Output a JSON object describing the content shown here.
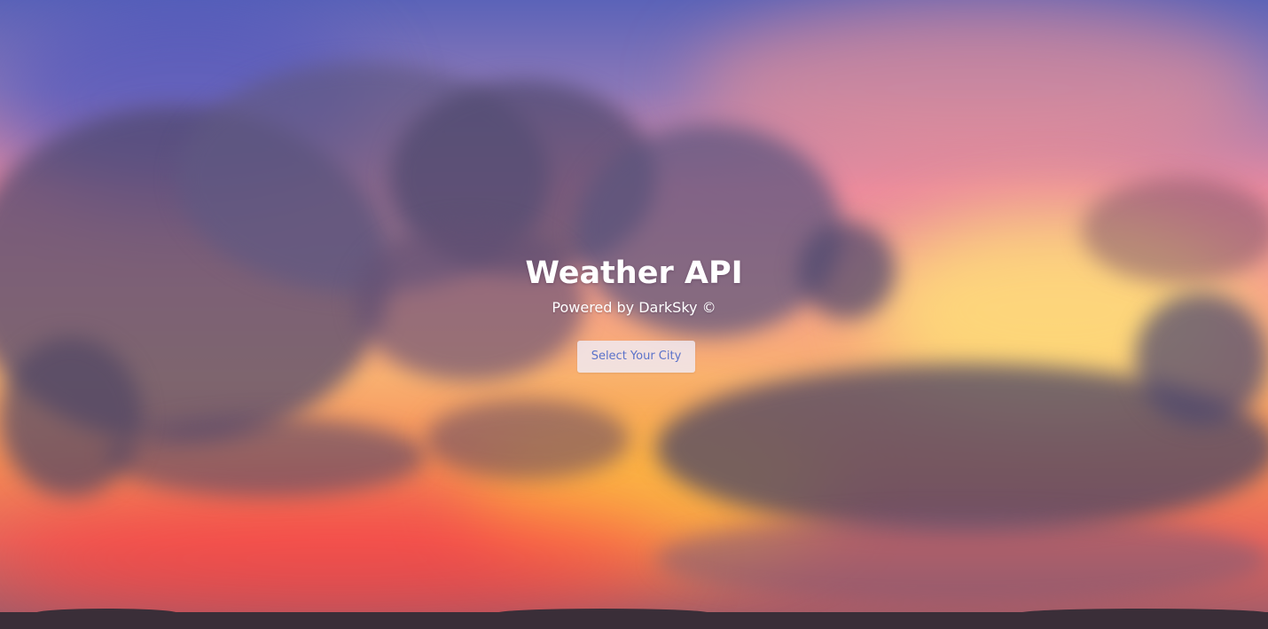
{
  "hero": {
    "title": "Weather API",
    "subtitle": "Powered by DarkSky ©",
    "select_city_label": "Select Your City"
  },
  "colors": {
    "title_text": "#ffffff",
    "button_background": "#f0ecf5",
    "button_text": "#5b72c9"
  },
  "background": {
    "description_icon": "sunset-clouds-image"
  }
}
